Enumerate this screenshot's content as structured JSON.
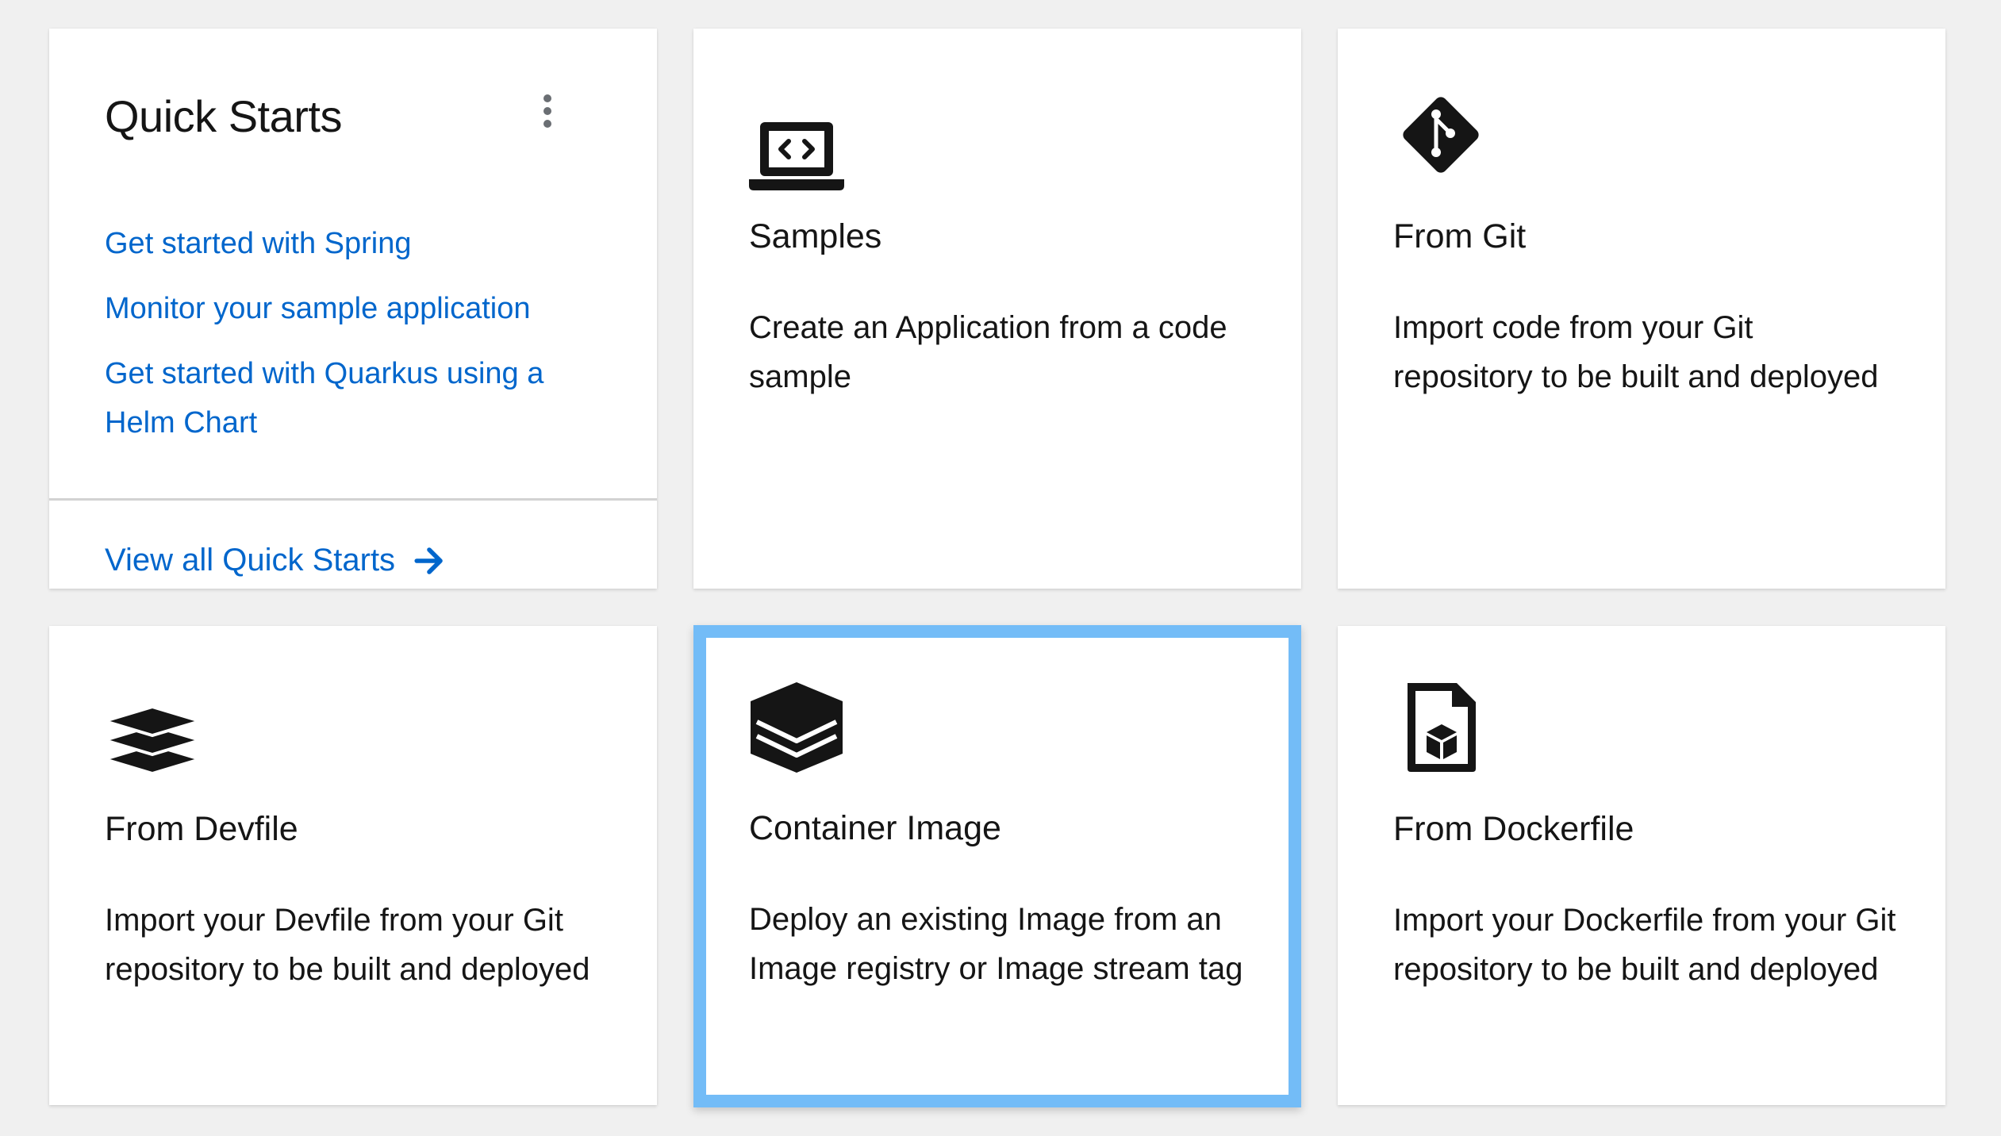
{
  "quick_starts": {
    "title": "Quick Starts",
    "links": [
      "Get started with Spring",
      "Monitor your sample application",
      "Get started with Quarkus using a Helm Chart"
    ],
    "view_all": "View all Quick Starts"
  },
  "tiles": [
    {
      "icon": "laptop-code-icon",
      "title": "Samples",
      "description": "Create an Application from a code sample"
    },
    {
      "icon": "git-icon",
      "title": "From Git",
      "description": "Import code from your Git repository to be built and deployed"
    },
    {
      "icon": "layer-group-icon",
      "title": "From Devfile",
      "description": "Import your Devfile from your Git repository to be built and deployed"
    },
    {
      "icon": "container-image-icon",
      "title": "Container Image",
      "description": "Deploy an existing Image from an Image registry or Image stream tag",
      "selected": true
    },
    {
      "icon": "dockerfile-icon",
      "title": "From Dockerfile",
      "description": "Import your Dockerfile from your Git repository to be built and deployed"
    }
  ],
  "colors": {
    "link": "#0066cc",
    "selected_border": "#73bcf7",
    "text": "#151515",
    "background": "#f0f0f0"
  }
}
